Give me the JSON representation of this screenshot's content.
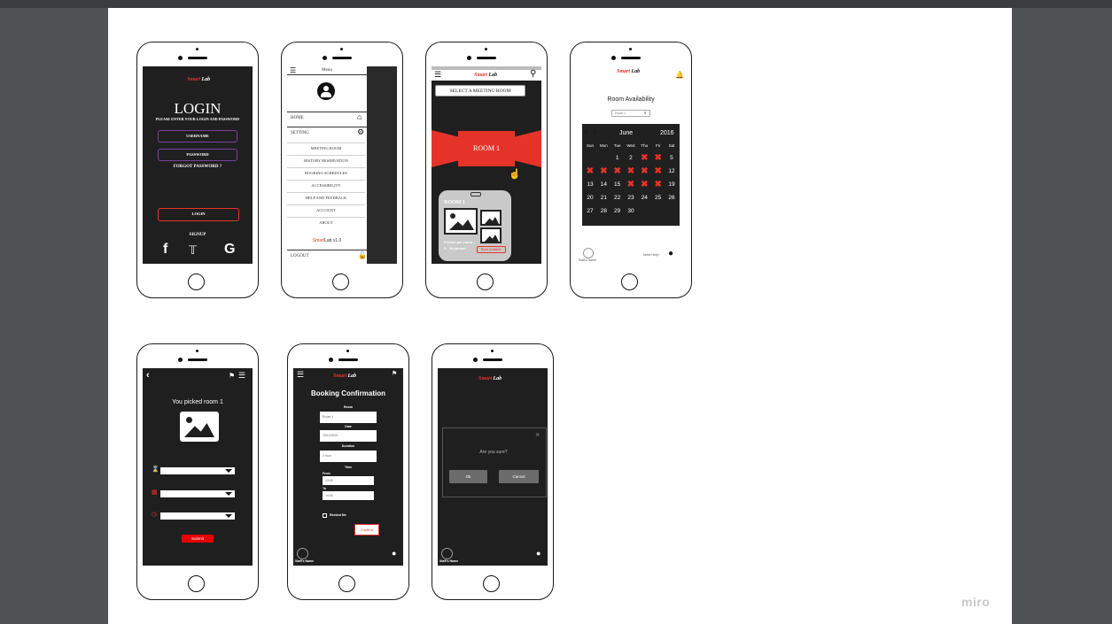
{
  "app": {
    "brand_logo": "miro"
  },
  "brand": {
    "first": "Smart",
    "second": "Lab"
  },
  "login": {
    "title": "LOGIN",
    "subtitle": "Please enter your login and password",
    "username_label": "Username",
    "password_label": "Password",
    "forgot": "Forgot password ?",
    "login_button": "Login",
    "signup": "SIGNUP",
    "social": [
      "f",
      "🐦",
      "G"
    ]
  },
  "menu": {
    "header": "Menu",
    "items_top": [
      {
        "label": "Home",
        "icon": "house-icon"
      },
      {
        "label": "Setting",
        "icon": "gear-icon"
      }
    ],
    "items": [
      "Meeting Room",
      "History Reservation",
      "Booking Schedules",
      "Accessibility",
      "Help and Feedback",
      "Account",
      "About"
    ],
    "version_red": "Smart",
    "version_rest": "Lab v1.0",
    "logout": "Logout"
  },
  "meeting": {
    "select_label": "Select a Meeting Room",
    "room_label": "ROOM 1",
    "card_title": "ROOM 1",
    "card_info_1": "Person per room :",
    "card_info_2": "5 - 10 person",
    "card_button": "Book Available"
  },
  "availability": {
    "title": "Room Availability",
    "dropdown": "Room 1",
    "month": "June",
    "year": "2016",
    "days": [
      "Sun",
      "Mon",
      "Tue",
      "Wed",
      "Thu",
      "Fri",
      "Sat"
    ],
    "weeks": [
      [
        "",
        "",
        "1",
        "2",
        "X",
        "X",
        "5"
      ],
      [
        "X",
        "X",
        "X",
        "X",
        "X",
        "X",
        "12"
      ],
      [
        "13",
        "14",
        "15",
        "X",
        "X",
        "X",
        "19"
      ],
      [
        "20",
        "21",
        "22",
        "23",
        "24",
        "25",
        "26"
      ],
      [
        "27",
        "28",
        "29",
        "30",
        "",
        "",
        ""
      ]
    ],
    "staff": "Staff's Name",
    "need_help": "Need Help?"
  },
  "pick": {
    "title": "You picked room 1",
    "submit": "Submit"
  },
  "booking": {
    "title": "Booking Confirmation",
    "room_label": "Room",
    "room_value": "Room 1",
    "date_label": "Date",
    "date_value": "15/12/2021",
    "duration_label": "Duration",
    "duration_value": "1 hour",
    "time_label": "Time",
    "from_label": "From",
    "from_value": "13:00",
    "to_label": "To",
    "to_value": "14:00",
    "remind": "Remind Me",
    "confirm": "Confirm",
    "staff": "Staff's Name"
  },
  "dialog": {
    "question": "Are you sure?",
    "ok": "Ok",
    "cancel": "Cancel",
    "staff": "Staff's Name"
  },
  "colors": {
    "accent": "#e6332a",
    "screen": "#1f1f1f",
    "purple": "#7b3fa0",
    "canvas": "#4f5253"
  }
}
